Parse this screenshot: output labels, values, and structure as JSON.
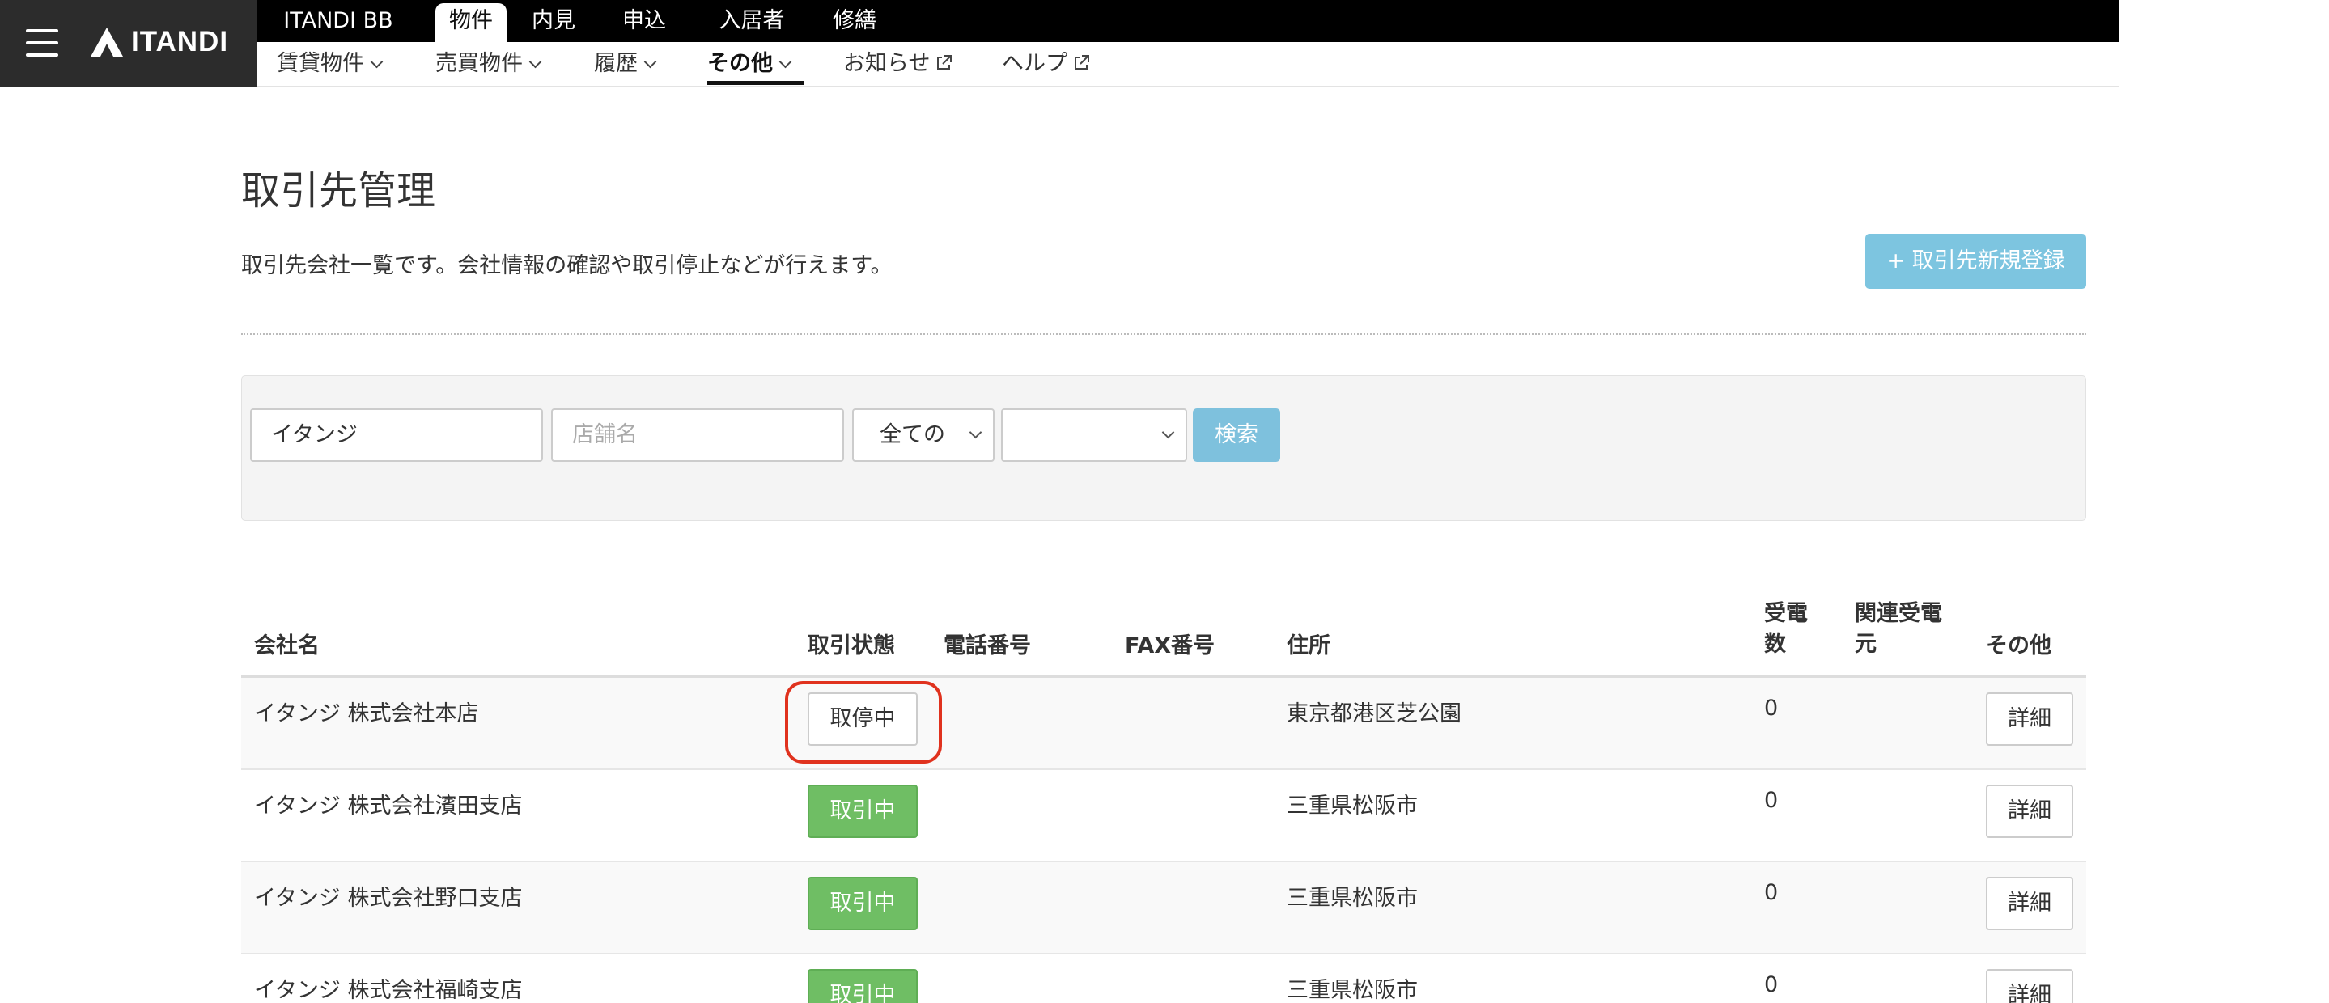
{
  "app": {
    "logo_text": "ITANDI"
  },
  "topnav": {
    "items": [
      {
        "label": "ITANDI BB"
      },
      {
        "label": "物件"
      },
      {
        "label": "内見"
      },
      {
        "label": "申込"
      },
      {
        "label": "入居者"
      },
      {
        "label": "修繕"
      }
    ],
    "active_index": 1
  },
  "subnav": {
    "items": [
      {
        "label": "賃貸物件"
      },
      {
        "label": "売買物件"
      },
      {
        "label": "履歴"
      },
      {
        "label": "その他"
      },
      {
        "label": "お知らせ"
      },
      {
        "label": "ヘルプ"
      }
    ],
    "active_index": 3
  },
  "page": {
    "title": "取引先管理",
    "description": "取引先会社一覧です。会社情報の確認や取引停止などが行えます。",
    "add_button_label": "+ 取引先新規登録"
  },
  "search": {
    "company_value": "イタンジ",
    "store_placeholder": "店舗名",
    "status_select_value": "全ての",
    "second_select_value": "",
    "button_label": "検索"
  },
  "table": {
    "headers": {
      "company": "会社名",
      "status": "取引状態",
      "phone": "電話番号",
      "fax": "FAX番号",
      "address": "住所",
      "calls_line1": "受電",
      "calls_line2": "数",
      "related_line1": "関連受電",
      "related_line2": "元",
      "other": "その他"
    },
    "rows": [
      {
        "company": "イタンジ 株式会社本店",
        "status": "取停中",
        "phone": "",
        "fax": "",
        "address": "東京都港区芝公園",
        "calls": "0",
        "related": "",
        "action": "詳細"
      },
      {
        "company": "イタンジ 株式会社濱田支店",
        "status": "取引中",
        "phone": "",
        "fax": "",
        "address": "三重県松阪市",
        "calls": "0",
        "related": "",
        "action": "詳細"
      },
      {
        "company": "イタンジ 株式会社野口支店",
        "status": "取引中",
        "phone": "",
        "fax": "",
        "address": "三重県松阪市",
        "calls": "0",
        "related": "",
        "action": "詳細"
      },
      {
        "company": "イタンジ 株式会社福崎支店",
        "status": "取引中",
        "phone": "",
        "fax": "",
        "address": "三重県松阪市",
        "calls": "0",
        "related": "",
        "action": "詳細"
      }
    ]
  },
  "colors": {
    "header_black": "#000000",
    "brand_dark": "#2c2c2c",
    "accent_blue": "#7dc5e0",
    "status_active_green": "#6fbe64",
    "highlight_red": "#e0321e"
  }
}
